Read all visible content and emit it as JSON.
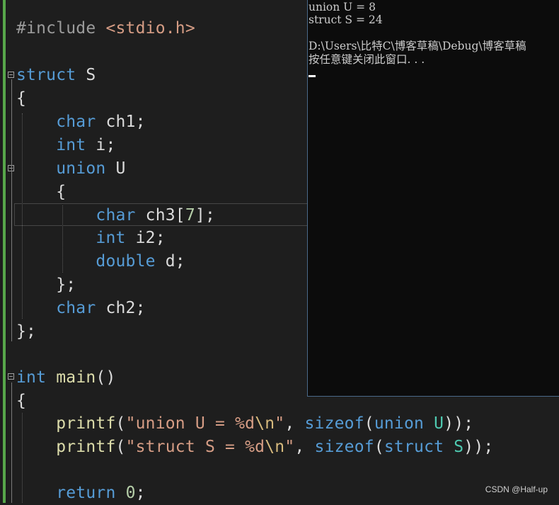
{
  "code": {
    "include": {
      "directive": "#include",
      "header": "<stdio.h>"
    },
    "struct_kw": "struct",
    "struct_name": "S",
    "open_brace": "{",
    "char_kw": "char",
    "ch1": " ch1;",
    "int_kw": "int",
    "i": " i;",
    "union_kw": "union",
    "union_name": "U",
    "inner_open": "{",
    "ch3_name": " ch3[",
    "ch3_size": "7",
    "ch3_end": "];",
    "i2": " i2;",
    "double_kw": "double",
    "d": " d;",
    "inner_close": "};",
    "ch2": " ch2;",
    "outer_close": "};",
    "main_name": "main",
    "main_parens": "()",
    "main_open": "{",
    "printf": "printf",
    "printf1_str": "\"union U = %d",
    "newline_esc": "\\n",
    "str_end": "\"",
    "printf1_rest_a": ", ",
    "sizeof": "sizeof",
    "printf1_arg": "union U",
    "printf1_close": "));",
    "printf2_str": "\"struct S = %d",
    "printf2_arg": "struct S",
    "return_kw": "return",
    "return_val": "0",
    "semicolon": ";"
  },
  "console": {
    "line1": "union U = 8",
    "line2": "struct S = 24",
    "line3": "D:\\Users\\比特C\\博客草稿\\Debug\\博客草稿",
    "line4": "按任意键关闭此窗口. . ."
  },
  "watermark": "CSDN @Half-up",
  "colors": {
    "editor_bg": "#1e1e1e",
    "keyword": "#569cd6",
    "function": "#dcdcaa",
    "string": "#d69d85",
    "console_bg": "#0c0c0c",
    "change_bar": "#57a64a"
  }
}
